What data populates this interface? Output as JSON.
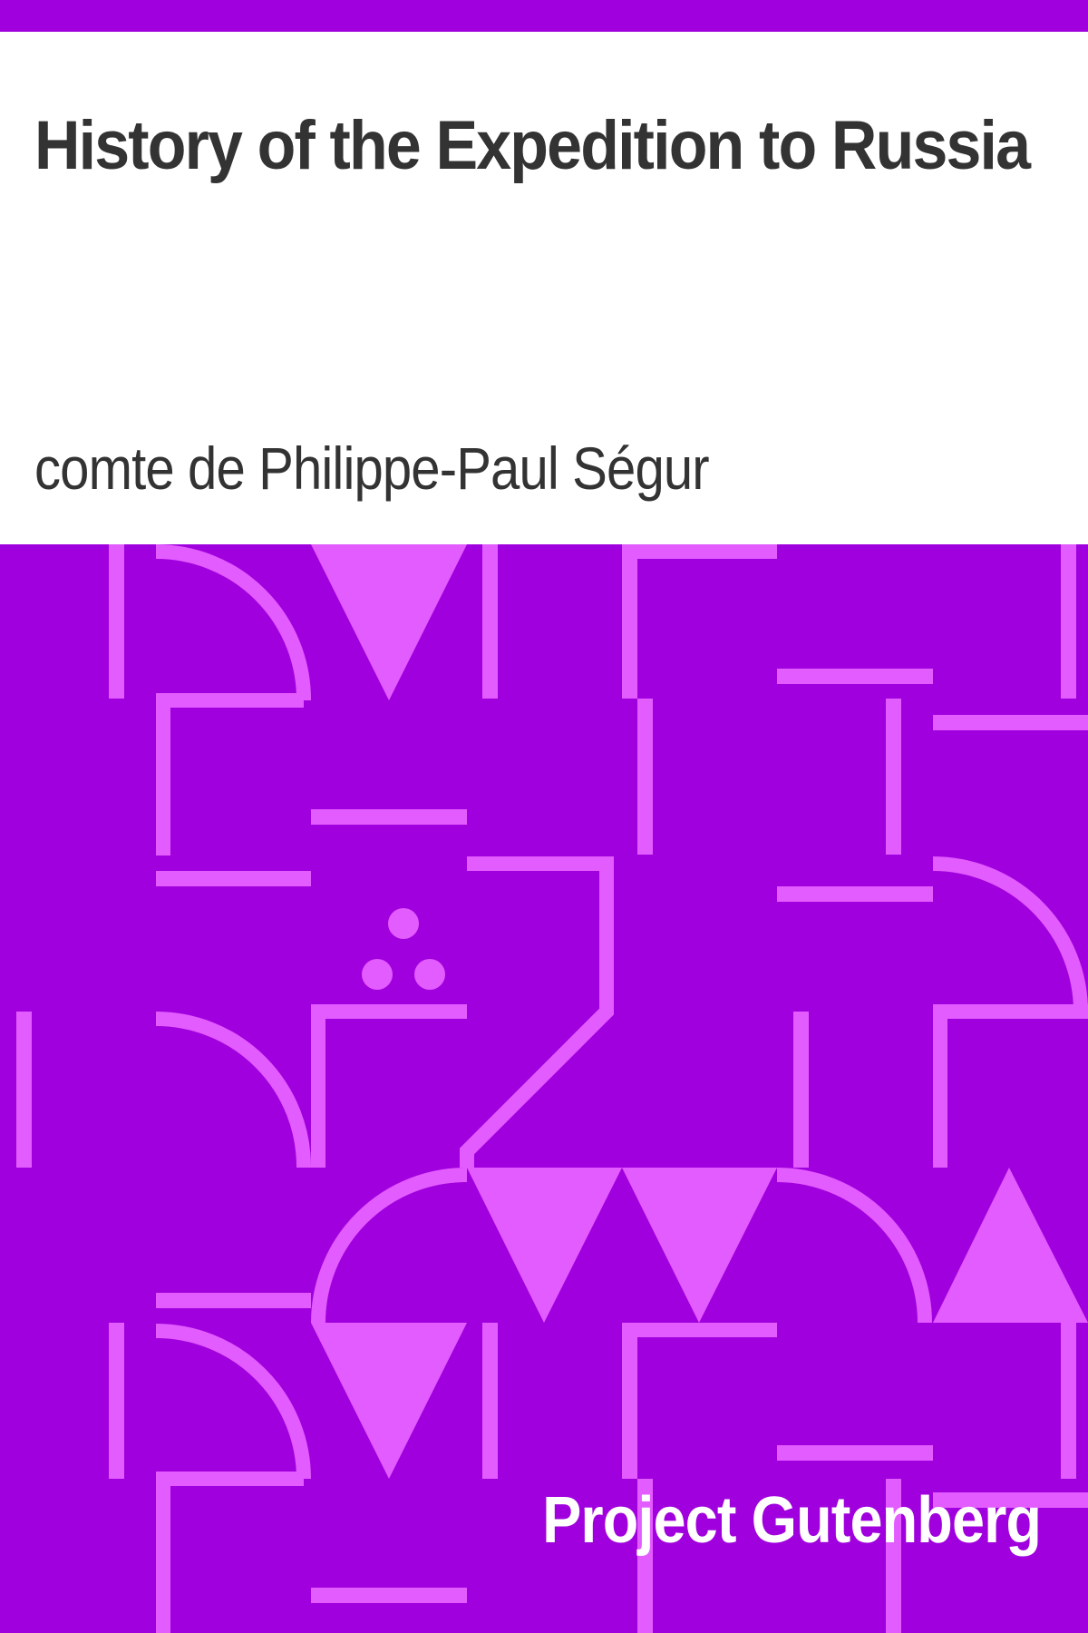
{
  "book": {
    "title": "History of the Expedition to Russia",
    "author": "comte de Philippe-Paul Ségur"
  },
  "publisher": {
    "name": "Project Gutenberg"
  },
  "colors": {
    "band": "#a000dd",
    "pattern_fill": "#e35cff",
    "text_dark": "#333333",
    "text_light": "#ffffff",
    "background": "#ffffff"
  }
}
